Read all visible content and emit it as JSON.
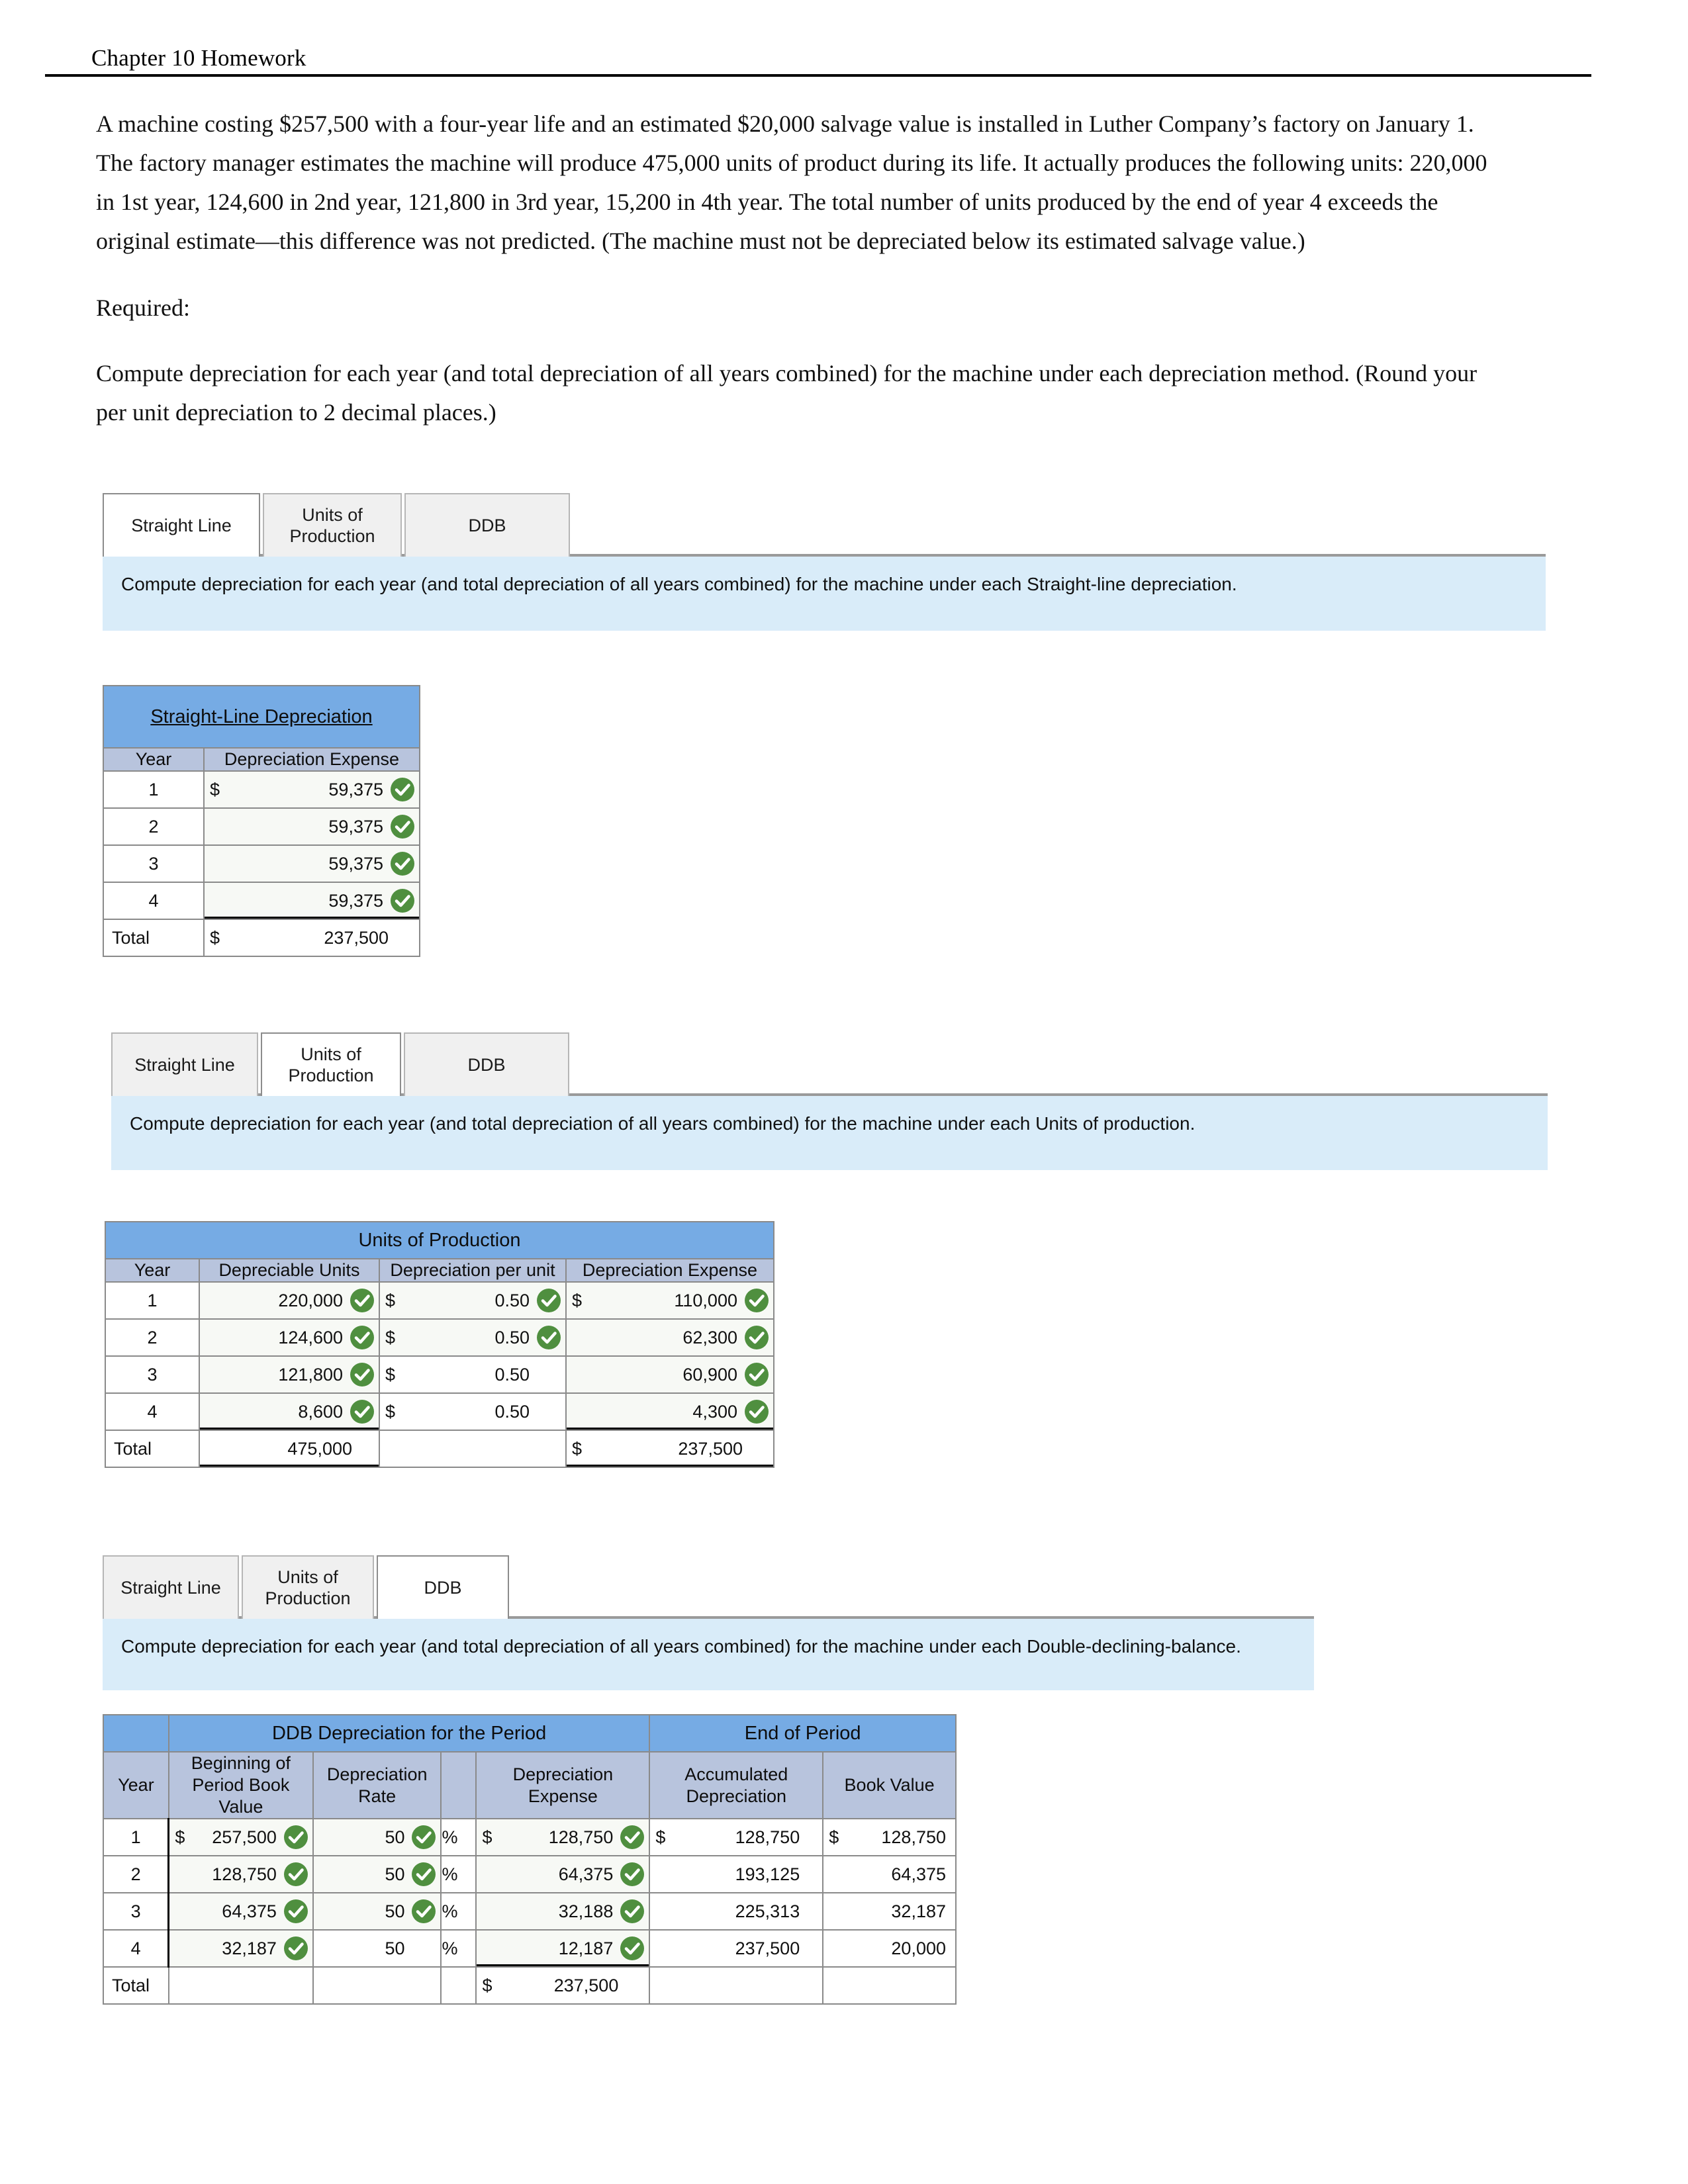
{
  "header": {
    "title": "Chapter 10 Homework"
  },
  "narrative": {
    "paragraphs": [
      "A machine costing $257,500 with a four-year life and an estimated $20,000 salvage value is installed in Luther Company’s factory on January 1. The factory manager estimates the machine will produce 475,000 units of product during its life. It actually produces the following units: 220,000 in 1st year, 124,600 in 2nd year, 121,800 in 3rd year, 15,200 in 4th year. The total number of units produced by the end of year 4 exceeds the original estimate—this difference was not predicted. (The machine must not be depreciated below its estimated salvage value.)",
      "Required:",
      "Compute depreciation for each year (and total depreciation of all years combined) for the machine under each depreciation method. (Round your per unit depreciation to 2 decimal places.)"
    ]
  },
  "tabs": {
    "labels": {
      "straight_line": "Straight Line",
      "units_of_production": "Units of Production",
      "ddb": "DDB"
    }
  },
  "sections": {
    "straight_line": {
      "prompt": "Compute depreciation for each year (and total depreciation of all years combined) for the machine under each Straight-line depreciation.",
      "table": {
        "title": "Straight-Line Depreciation",
        "columns": [
          "Year",
          "Depreciation Expense"
        ],
        "rows": [
          {
            "year": "1",
            "currency": "$",
            "expense": "59,375",
            "check": true
          },
          {
            "year": "2",
            "currency": "",
            "expense": "59,375",
            "check": true
          },
          {
            "year": "3",
            "currency": "",
            "expense": "59,375",
            "check": true
          },
          {
            "year": "4",
            "currency": "",
            "expense": "59,375",
            "check": true
          }
        ],
        "total": {
          "label": "Total",
          "currency": "$",
          "expense": "237,500"
        }
      }
    },
    "units_of_production": {
      "prompt": "Compute depreciation for each year (and total depreciation of all years combined) for the machine under each Units of production.",
      "table": {
        "title": "Units of Production",
        "columns": [
          "Year",
          "Depreciable Units",
          "Depreciation per unit",
          "Depreciation Expense"
        ],
        "rows": [
          {
            "year": "1",
            "units": "220,000",
            "units_check": true,
            "rate_cur": "$",
            "rate": "0.50",
            "rate_check": true,
            "exp_cur": "$",
            "expense": "110,000",
            "exp_check": true
          },
          {
            "year": "2",
            "units": "124,600",
            "units_check": true,
            "rate_cur": "$",
            "rate": "0.50",
            "rate_check": true,
            "exp_cur": "",
            "expense": "62,300",
            "exp_check": true
          },
          {
            "year": "3",
            "units": "121,800",
            "units_check": true,
            "rate_cur": "$",
            "rate": "0.50",
            "rate_check": false,
            "exp_cur": "",
            "expense": "60,900",
            "exp_check": true
          },
          {
            "year": "4",
            "units": "8,600",
            "units_check": true,
            "rate_cur": "$",
            "rate": "0.50",
            "rate_check": false,
            "exp_cur": "",
            "expense": "4,300",
            "exp_check": true
          }
        ],
        "total": {
          "label": "Total",
          "units": "475,000",
          "rate": "",
          "exp_cur": "$",
          "expense": "237,500"
        }
      }
    },
    "ddb": {
      "prompt": "Compute depreciation for each year (and total depreciation of all years combined) for the machine under each Double-declining-balance.",
      "table": {
        "group_headers": [
          "DDB Depreciation for the Period",
          "End of Period"
        ],
        "columns": [
          "Year",
          "Beginning of Period Book Value",
          "Depreciation Rate",
          "Depreciation Expense",
          "Accumulated Depreciation",
          "Book Value"
        ],
        "percent_symbol": "%",
        "rows": [
          {
            "year": "1",
            "bv_cur": "$",
            "begin_bv": "257,500",
            "bv_check": true,
            "rate": "50",
            "rate_check": true,
            "exp_cur": "$",
            "expense": "128,750",
            "exp_check": true,
            "acc_cur": "$",
            "accumulated": "128,750",
            "end_cur": "$",
            "book_value": "128,750"
          },
          {
            "year": "2",
            "bv_cur": "",
            "begin_bv": "128,750",
            "bv_check": true,
            "rate": "50",
            "rate_check": true,
            "exp_cur": "",
            "expense": "64,375",
            "exp_check": true,
            "acc_cur": "",
            "accumulated": "193,125",
            "end_cur": "",
            "book_value": "64,375"
          },
          {
            "year": "3",
            "bv_cur": "",
            "begin_bv": "64,375",
            "bv_check": true,
            "rate": "50",
            "rate_check": true,
            "exp_cur": "",
            "expense": "32,188",
            "exp_check": true,
            "acc_cur": "",
            "accumulated": "225,313",
            "end_cur": "",
            "book_value": "32,187"
          },
          {
            "year": "4",
            "bv_cur": "",
            "begin_bv": "32,187",
            "bv_check": true,
            "rate": "50",
            "rate_check": false,
            "exp_cur": "",
            "expense": "12,187",
            "exp_check": true,
            "acc_cur": "",
            "accumulated": "237,500",
            "end_cur": "",
            "book_value": "20,000"
          }
        ],
        "total": {
          "label": "Total",
          "exp_cur": "$",
          "expense": "237,500"
        }
      }
    }
  },
  "colors": {
    "table_title_blue": "#76abe4",
    "column_header_blue": "#b8c4dd",
    "prompt_band_blue": "#d9ecf9",
    "check_green": "#4f8f3f",
    "tab_inactive": "#f0f0f0"
  }
}
